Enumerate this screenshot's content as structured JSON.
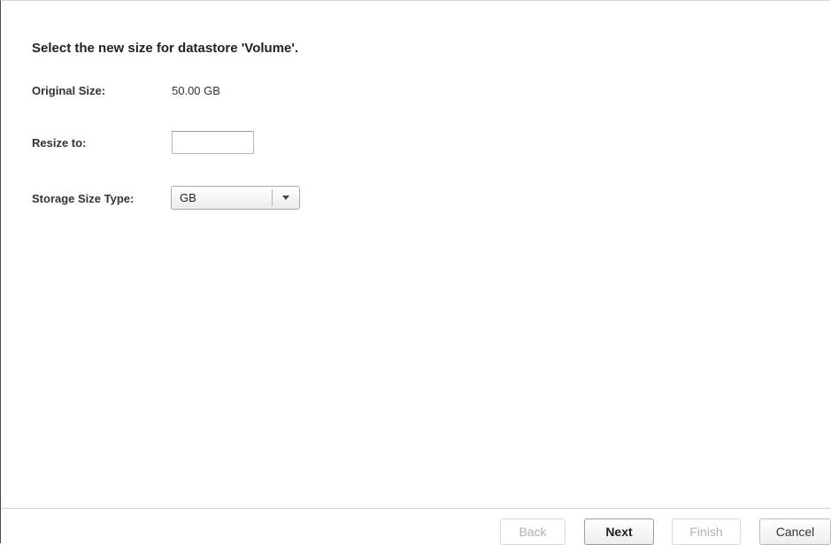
{
  "dialog": {
    "heading": "Select the new size for datastore 'Volume'."
  },
  "form": {
    "original_size_label": "Original Size:",
    "original_size_value": "50.00 GB",
    "resize_label": "Resize to:",
    "resize_value": "",
    "size_type_label": "Storage Size Type:",
    "size_type_selected": "GB"
  },
  "footer": {
    "back_label": "Back",
    "next_label": "Next",
    "finish_label": "Finish",
    "cancel_label": "Cancel"
  },
  "icons": {
    "dropdown": "triangle-down-icon"
  },
  "colors": {
    "disabled_text": "#b0b0b0",
    "divider": "#d2d2d2",
    "text": "#333333"
  }
}
